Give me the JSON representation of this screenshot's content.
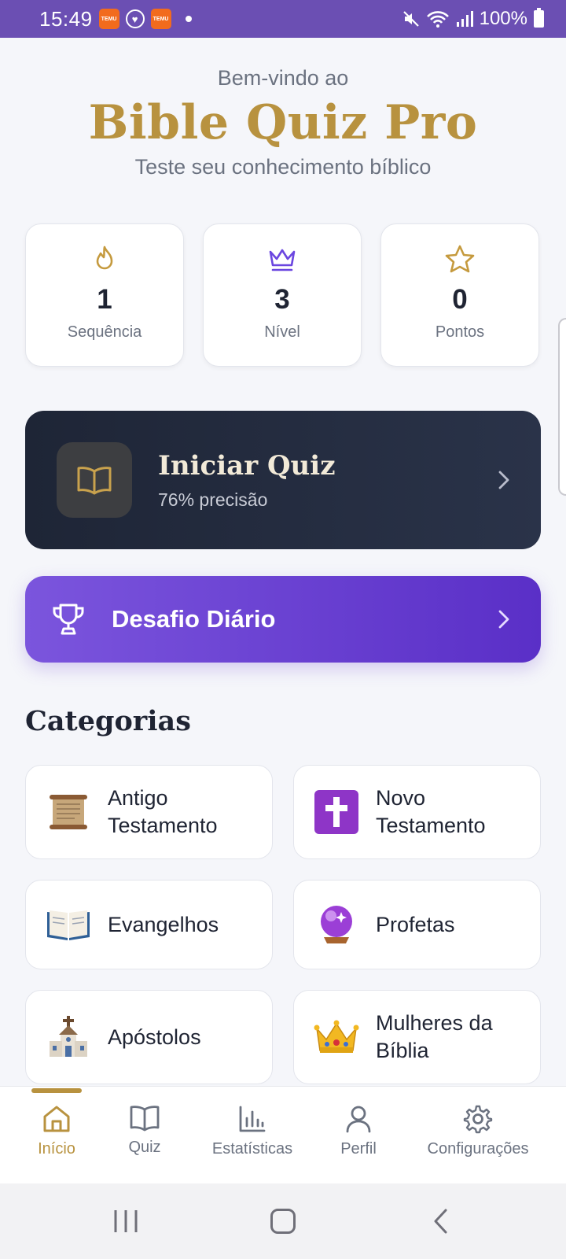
{
  "status_bar": {
    "time": "15:49",
    "temu_label": "TEMU",
    "battery": "100%"
  },
  "header": {
    "welcome": "Bem-vindo ao",
    "title": "Bible Quiz Pro",
    "subtitle": "Teste seu conhecimento bíblico"
  },
  "stats": [
    {
      "icon": "flame-icon",
      "value": "1",
      "label": "Sequência"
    },
    {
      "icon": "crown-icon",
      "value": "3",
      "label": "Nível"
    },
    {
      "icon": "star-icon",
      "value": "0",
      "label": "Pontos"
    }
  ],
  "quiz_card": {
    "title": "Iniciar Quiz",
    "subtitle": "76% precisão",
    "icon": "book-icon"
  },
  "challenge": {
    "label": "Desafio Diário",
    "icon": "trophy-icon"
  },
  "categories": {
    "title": "Categorias",
    "items": [
      {
        "line1": "Antigo",
        "line2": "Testamento",
        "icon": "scroll-icon"
      },
      {
        "line1": "Novo",
        "line2": "Testamento",
        "icon": "cross-icon"
      },
      {
        "line1": "Evangelhos",
        "line2": "",
        "icon": "open-book-icon"
      },
      {
        "line1": "Profetas",
        "line2": "",
        "icon": "crystal-ball-icon"
      },
      {
        "line1": "Apóstolos",
        "line2": "",
        "icon": "church-icon"
      },
      {
        "line1": "Mulheres da",
        "line2": "Bíblia",
        "icon": "crown-emoji-icon"
      }
    ]
  },
  "bottom_nav": {
    "items": [
      {
        "label": "Início",
        "icon": "home-icon",
        "active": true
      },
      {
        "label": "Quiz",
        "icon": "book-icon",
        "active": false
      },
      {
        "label": "Estatísticas",
        "icon": "bar-chart-icon",
        "active": false
      },
      {
        "label": "Perfil",
        "icon": "user-icon",
        "active": false
      },
      {
        "label": "Configurações",
        "icon": "gear-icon",
        "active": false
      }
    ]
  },
  "colors": {
    "status_bar": "#6b4fb3",
    "gold": "#b8923f",
    "purple": "#6b46e0",
    "dark_card": "#1e2536"
  }
}
